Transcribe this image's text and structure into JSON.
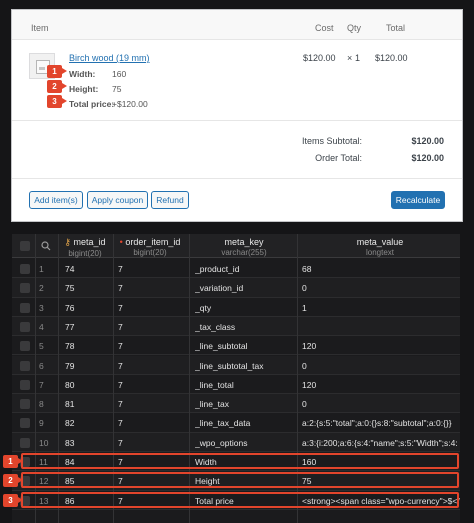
{
  "order_items": {
    "header": {
      "item": "Item",
      "cost": "Cost",
      "qty": "Qty",
      "total": "Total"
    },
    "product": {
      "name": "Birch wood (19 mm)",
      "cost": "$120.00",
      "qty_sep": "×",
      "qty": "1",
      "total": "$120.00"
    },
    "meta": [
      {
        "label": "Width:",
        "value": "160",
        "badge": "1"
      },
      {
        "label": "Height:",
        "value": "75",
        "badge": "2"
      },
      {
        "label": "Total price:",
        "value": "+$120.00",
        "badge": "3"
      }
    ],
    "totals": [
      {
        "label": "Items Subtotal:",
        "value": "$120.00"
      },
      {
        "label": "Order Total:",
        "value": "$120.00"
      }
    ],
    "buttons": {
      "add_items": "Add item(s)",
      "apply_coupon": "Apply coupon",
      "refund": "Refund",
      "recalculate": "Recalculate"
    }
  },
  "db_grid": {
    "columns": [
      {
        "name": "meta_id",
        "type": "bigint(20)",
        "icon": "key-icon"
      },
      {
        "name": "order_item_id",
        "type": "bigint(20)",
        "icon": "index-dot-icon"
      },
      {
        "name": "meta_key",
        "type": "varchar(255)"
      },
      {
        "name": "meta_value",
        "type": "longtext"
      }
    ],
    "rows": [
      {
        "n": "1",
        "meta_id": "74",
        "order_item_id": "7",
        "meta_key": "_product_id",
        "meta_value": "68"
      },
      {
        "n": "2",
        "meta_id": "75",
        "order_item_id": "7",
        "meta_key": "_variation_id",
        "meta_value": "0"
      },
      {
        "n": "3",
        "meta_id": "76",
        "order_item_id": "7",
        "meta_key": "_qty",
        "meta_value": "1"
      },
      {
        "n": "4",
        "meta_id": "77",
        "order_item_id": "7",
        "meta_key": "_tax_class",
        "meta_value": ""
      },
      {
        "n": "5",
        "meta_id": "78",
        "order_item_id": "7",
        "meta_key": "_line_subtotal",
        "meta_value": "120"
      },
      {
        "n": "6",
        "meta_id": "79",
        "order_item_id": "7",
        "meta_key": "_line_subtotal_tax",
        "meta_value": "0"
      },
      {
        "n": "7",
        "meta_id": "80",
        "order_item_id": "7",
        "meta_key": "_line_total",
        "meta_value": "120"
      },
      {
        "n": "8",
        "meta_id": "81",
        "order_item_id": "7",
        "meta_key": "_line_tax",
        "meta_value": "0"
      },
      {
        "n": "9",
        "meta_id": "82",
        "order_item_id": "7",
        "meta_key": "_line_tax_data",
        "meta_value": "a:2:{s:5:\"total\";a:0:{}s:8:\"subtotal\";a:0:{}}"
      },
      {
        "n": "10",
        "meta_id": "83",
        "order_item_id": "7",
        "meta_key": "_wpo_options",
        "meta_value": "a:3:{i:200;a:6:{s:4:\"name\";s:5:\"Width\";s:4:"
      },
      {
        "n": "11",
        "meta_id": "84",
        "order_item_id": "7",
        "meta_key": "Width",
        "meta_value": "160",
        "badge": "1"
      },
      {
        "n": "12",
        "meta_id": "85",
        "order_item_id": "7",
        "meta_key": "Height",
        "meta_value": "75",
        "badge": "2"
      },
      {
        "n": "13",
        "meta_id": "86",
        "order_item_id": "7",
        "meta_key": "Total price",
        "meta_value": "<strong><span class=\"wpo-currency\">$</span>",
        "badge": "3"
      }
    ]
  },
  "colors": {
    "badge": "#e2452c",
    "link": "#2271b1",
    "grid_bg": "#1b1b1d"
  }
}
